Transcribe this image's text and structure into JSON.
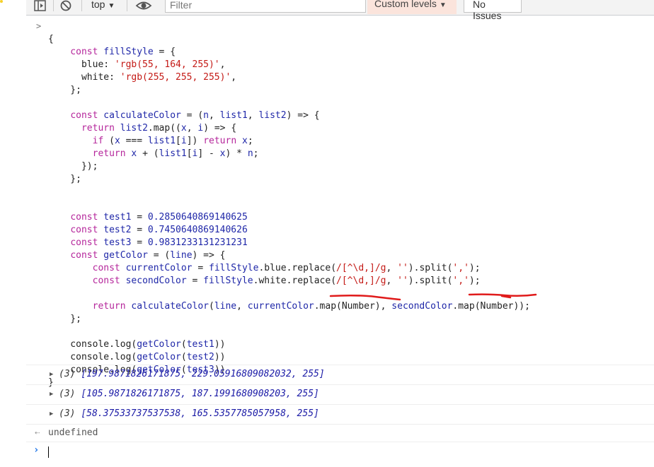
{
  "toolbar": {
    "context_label": "top",
    "filter_placeholder": "Filter",
    "levels_label": "Custom levels",
    "issues_label": "No Issues"
  },
  "code": {
    "prompt_glyph": ">",
    "lines": [
      "{",
      "    const fillStyle = {",
      "      blue: 'rgb(55, 164, 255)',",
      "      white: 'rgb(255, 255, 255)',",
      "    };",
      "",
      "    const calculateColor = (n, list1, list2) => {",
      "      return list2.map((x, i) => {",
      "        if (x === list1[i]) return x;",
      "        return x + (list1[i] - x) * n;",
      "      });",
      "    };",
      "",
      "",
      "    const test1 = 0.2850640869140625",
      "    const test2 = 0.7450640869140626",
      "    const test3 = 0.9831233131231231",
      "    const getColor = (line) => {",
      "        const currentColor = fillStyle.blue.replace(/[^\\d,]/g, '').split(',');",
      "        const secondColor = fillStyle.white.replace(/[^\\d,]/g, '').split(',');",
      "",
      "        return calculateColor(line, currentColor.map(Number), secondColor.map(Number));",
      "    };",
      "",
      "    console.log(getColor(test1))",
      "    console.log(getColor(test2))",
      "    console.log(getColor(test3))",
      "}"
    ]
  },
  "results": [
    {
      "count": "(3)",
      "values": "[197.9871826171875, 229.05916809082032, 255]"
    },
    {
      "count": "(3)",
      "values": "[105.9871826171875, 187.1991680908203, 255]"
    },
    {
      "count": "(3)",
      "values": "[58.37533737537538, 165.5357785057958, 255]"
    }
  ],
  "return_value": "undefined",
  "colors": {
    "keyword": "#b5269b",
    "identifier": "#1f27a8",
    "string": "#c41a16",
    "annotation_underline": "#e01b1b"
  }
}
